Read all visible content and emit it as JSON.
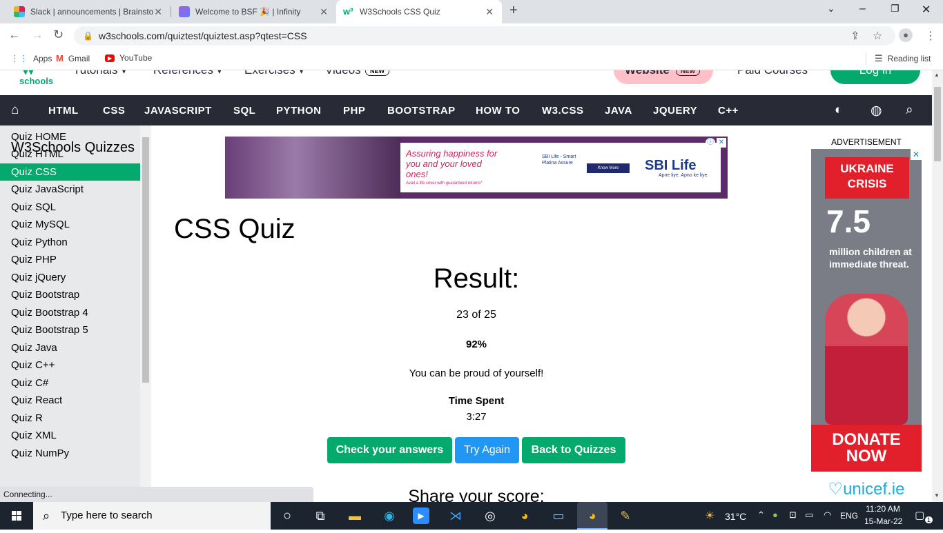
{
  "browser": {
    "tabs": [
      {
        "title": "Slack | announcements | Brainsto",
        "active": false
      },
      {
        "title": "Welcome to BSF 🎉 | Infinity",
        "active": false
      },
      {
        "title": "W3Schools CSS Quiz",
        "active": true
      }
    ],
    "url": "w3schools.com/quiztest/quiztest.asp?qtest=CSS",
    "bookmarks": [
      "Apps",
      "Gmail",
      "YouTube"
    ],
    "reading_list": "Reading list",
    "status_text": "Connecting..."
  },
  "site": {
    "logo": "schools",
    "top_items": [
      "Tutorials ▾",
      "References ▾",
      "Exercises ▾",
      "Videos"
    ],
    "new_badge": "NEW",
    "website_button": "Website",
    "paid_courses": "Paid Courses",
    "login_button": "Log in",
    "main_nav": [
      "HTML",
      "CSS",
      "JAVASCRIPT",
      "SQL",
      "PYTHON",
      "PHP",
      "BOOTSTRAP",
      "HOW TO",
      "W3.CSS",
      "JAVA",
      "JQUERY",
      "C++"
    ]
  },
  "sidebar": {
    "title": "W3Schools Quizzes",
    "items": [
      "Quiz HOME",
      "Quiz HTML",
      "Quiz CSS",
      "Quiz JavaScript",
      "Quiz SQL",
      "Quiz MySQL",
      "Quiz Python",
      "Quiz PHP",
      "Quiz jQuery",
      "Quiz Bootstrap",
      "Quiz Bootstrap 4",
      "Quiz Bootstrap 5",
      "Quiz Java",
      "Quiz C++",
      "Quiz C#",
      "Quiz React",
      "Quiz R",
      "Quiz XML",
      "Quiz NumPy"
    ],
    "active_index": 2
  },
  "main": {
    "title": "CSS Quiz",
    "result_heading": "Result:",
    "score": "23 of 25",
    "percent": "92%",
    "message": "You can be proud of yourself!",
    "time_label": "Time Spent",
    "time_value": "3:27",
    "buttons": {
      "check": "Check your answers",
      "try": "Try Again",
      "back": "Back to Quizzes"
    },
    "share": "Share your score:"
  },
  "ad_banner": {
    "tagline": "Assuring happiness for you and your loved ones!",
    "sub": "Avail a life cover with guaranteed returns*",
    "product": "SBI Life - Smart Platina Assure",
    "cta": "Know More",
    "brand": "SBI Life",
    "brand_sub": "Apne liye. Apno ke liye."
  },
  "ad_side": {
    "label": "ADVERTISEMENT",
    "headline": "UKRAINE CRISIS",
    "number": "7.5",
    "text": "million children at immediate threat.",
    "donate": "DONATE NOW",
    "org": "unicef.ie"
  },
  "taskbar": {
    "search_placeholder": "Type here to search",
    "weather": "31°C",
    "lang": "ENG",
    "time": "11:20 AM",
    "date": "15-Mar-22",
    "notifications": "1"
  },
  "colors": {
    "accent": "#04aa6d",
    "nav": "#282a35",
    "try_again": "#2196f3"
  }
}
